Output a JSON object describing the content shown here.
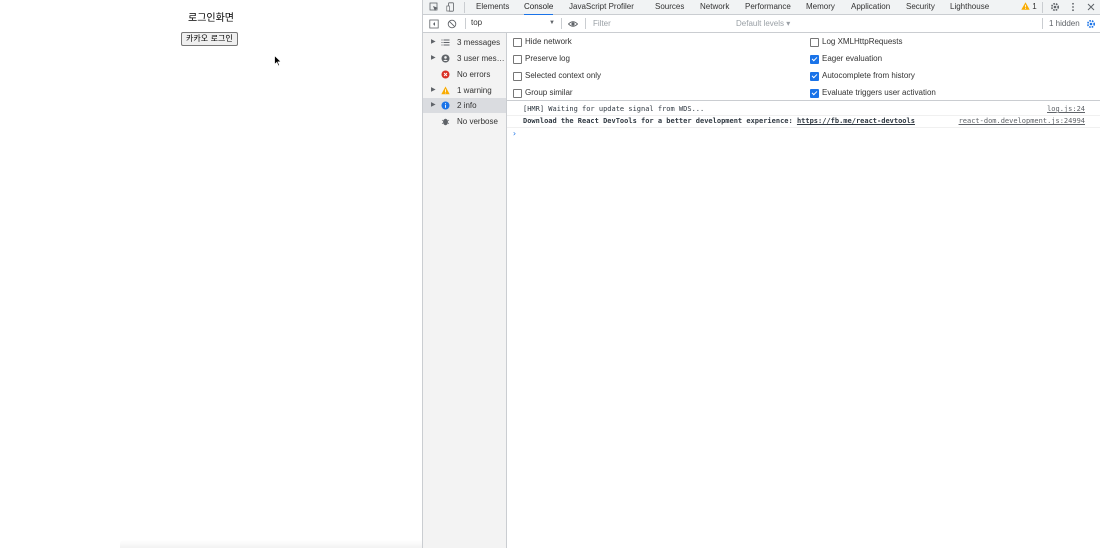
{
  "page": {
    "title": "로그인화면",
    "kakao_button": "카카오 로그인"
  },
  "devtools": {
    "tabs": [
      {
        "label": "Elements",
        "active": false
      },
      {
        "label": "Console",
        "active": true
      },
      {
        "label": "JavaScript Profiler",
        "active": false
      },
      {
        "label": "Sources",
        "active": false
      },
      {
        "label": "Network",
        "active": false
      },
      {
        "label": "Performance",
        "active": false
      },
      {
        "label": "Memory",
        "active": false
      },
      {
        "label": "Application",
        "active": false
      },
      {
        "label": "Security",
        "active": false
      },
      {
        "label": "Lighthouse",
        "active": false
      }
    ],
    "warning_count": "1",
    "toolbar": {
      "context": "top",
      "filter_placeholder": "Filter",
      "levels": "Default levels ▾",
      "hidden": "1 hidden"
    },
    "sidebar": [
      {
        "label": "3 messages",
        "icon": "list-icon",
        "expandable": true,
        "selected": false
      },
      {
        "label": "3 user mes…",
        "icon": "user-icon",
        "expandable": true,
        "selected": false
      },
      {
        "label": "No errors",
        "icon": "error-icon",
        "expandable": false,
        "selected": false
      },
      {
        "label": "1 warning",
        "icon": "warning-icon",
        "expandable": true,
        "selected": false
      },
      {
        "label": "2 info",
        "icon": "info-icon",
        "expandable": true,
        "selected": true
      },
      {
        "label": "No verbose",
        "icon": "bug-icon",
        "expandable": false,
        "selected": false
      }
    ],
    "settings": {
      "left": [
        {
          "label": "Hide network",
          "checked": false
        },
        {
          "label": "Preserve log",
          "checked": false
        },
        {
          "label": "Selected context only",
          "checked": false
        },
        {
          "label": "Group similar",
          "checked": false
        }
      ],
      "right": [
        {
          "label": "Log XMLHttpRequests",
          "checked": false
        },
        {
          "label": "Eager evaluation",
          "checked": true
        },
        {
          "label": "Autocomplete from history",
          "checked": true
        },
        {
          "label": "Evaluate triggers user activation",
          "checked": true
        }
      ]
    },
    "messages": [
      {
        "text": "[HMR] Waiting for update signal from WDS...",
        "source": "log.js:24"
      },
      {
        "text": "Download the React DevTools for a better development experience: ",
        "link": "https://fb.me/react-devtools",
        "source": "react-dom.development.js:24994"
      }
    ],
    "prompt": "›"
  },
  "colors": {
    "accent": "#1a73e8",
    "error": "#d93025",
    "warning": "#f9ab00"
  }
}
